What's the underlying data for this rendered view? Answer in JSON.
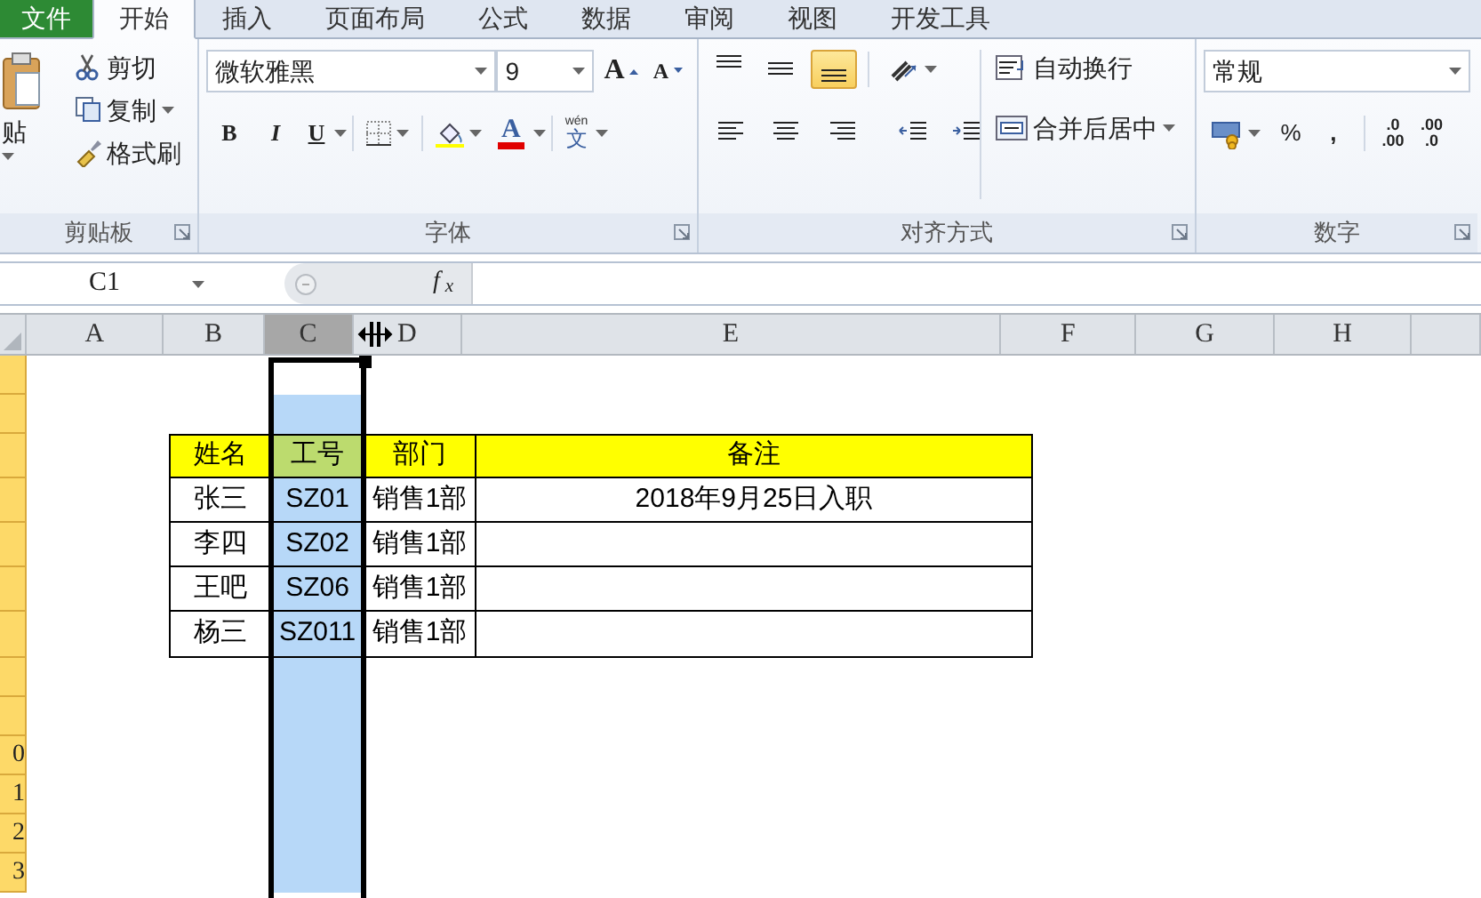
{
  "ribbon_tabs": [
    {
      "label": "文件",
      "kind": "file",
      "selected": false
    },
    {
      "label": "开始",
      "kind": "tab",
      "selected": true
    },
    {
      "label": "插入",
      "kind": "tab",
      "selected": false
    },
    {
      "label": "页面布局",
      "kind": "tab",
      "selected": false
    },
    {
      "label": "公式",
      "kind": "tab",
      "selected": false
    },
    {
      "label": "数据",
      "kind": "tab",
      "selected": false
    },
    {
      "label": "审阅",
      "kind": "tab",
      "selected": false
    },
    {
      "label": "视图",
      "kind": "tab",
      "selected": false
    },
    {
      "label": "开发工具",
      "kind": "tab",
      "selected": false
    }
  ],
  "clipboard": {
    "paste": "贴",
    "cut": "剪切",
    "copy": "复制",
    "format_painter": "格式刷",
    "group_label": "剪贴板"
  },
  "font": {
    "font_name": "微软雅黑",
    "font_size": "9",
    "grow": "A",
    "shrink": "A",
    "bold": "B",
    "italic": "I",
    "underline": "U",
    "font_color": "A",
    "phonetic": "文",
    "phonetic_ruby": "wén",
    "group_label": "字体"
  },
  "alignment": {
    "vertical": [
      {
        "kind": "top",
        "selected": false
      },
      {
        "kind": "middle",
        "selected": false
      },
      {
        "kind": "bottom",
        "selected": true
      }
    ],
    "wrap_text": "自动换行",
    "merge_center": "合并后居中",
    "group_label": "对齐方式"
  },
  "number": {
    "format": "常规",
    "percent": "%",
    "comma": ",",
    "increase_decimal": [
      ".0",
      ".00"
    ],
    "decrease_decimal": [
      ".00",
      ".0"
    ],
    "group_label": "数字"
  },
  "formula_bar": {
    "name_box": "C1",
    "function_label": "f$_{x}$"
  },
  "columns": [
    {
      "label": "A",
      "selected": false
    },
    {
      "label": "B",
      "selected": false
    },
    {
      "label": "C",
      "selected": true
    },
    {
      "label": "D",
      "selected": false
    },
    {
      "label": "E",
      "selected": false
    },
    {
      "label": "F",
      "selected": false
    },
    {
      "label": "G",
      "selected": false
    },
    {
      "label": "H",
      "selected": false
    },
    {
      "selected": false
    }
  ],
  "rows": [
    {
      "highlighted": true
    },
    {
      "highlighted": true
    },
    {
      "highlighted": true
    },
    {
      "highlighted": true
    },
    {
      "highlighted": true
    },
    {
      "highlighted": true
    },
    {
      "highlighted": true
    },
    {
      "highlighted": true
    },
    {
      "highlighted": true
    },
    {
      "label": "0",
      "highlighted": true
    },
    {
      "label": "1",
      "highlighted": true
    },
    {
      "label": "2",
      "highlighted": true
    },
    {
      "label": "3",
      "highlighted": true
    }
  ],
  "table": {
    "header": [
      "姓名",
      "工号",
      "部门",
      "备注"
    ],
    "rows": [
      [
        "张三",
        "SZ01",
        "销售1部",
        "2018年9月25日入职"
      ],
      [
        "李四",
        "SZ02",
        "销售1部"
      ],
      [
        "王吧",
        "SZ06",
        "销售1部"
      ],
      [
        "杨三",
        "SZ011",
        "销售1部"
      ]
    ]
  }
}
